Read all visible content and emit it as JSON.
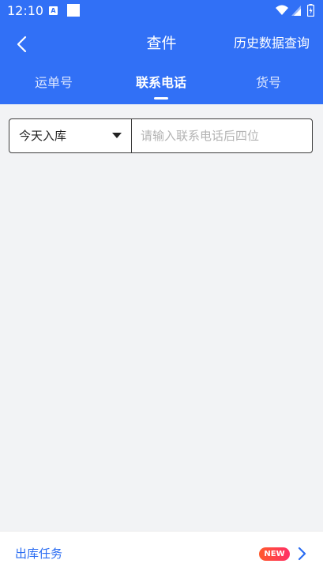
{
  "status_bar": {
    "time": "12:10",
    "left_icons": [
      "a-badge-icon",
      "square-icon"
    ],
    "right_icons": [
      "wifi-icon",
      "signal-icon",
      "battery-icon"
    ]
  },
  "header": {
    "back_icon": "chevron-left-icon",
    "title": "查件",
    "history_label": "历史数据查询"
  },
  "tabs": [
    {
      "label": "运单号",
      "active": false
    },
    {
      "label": "联系电话",
      "active": true
    },
    {
      "label": "货号",
      "active": false
    }
  ],
  "search": {
    "range_value": "今天入库",
    "input_value": "",
    "placeholder": "请输入联系电话后四位"
  },
  "bottom": {
    "label": "出库任务",
    "badge": "NEW"
  },
  "colors": {
    "brand": "#3170f6",
    "link": "#2a6cf2",
    "background": "#f2f3f5",
    "badge_start": "#ff5a2c",
    "badge_end": "#ff2f66"
  }
}
